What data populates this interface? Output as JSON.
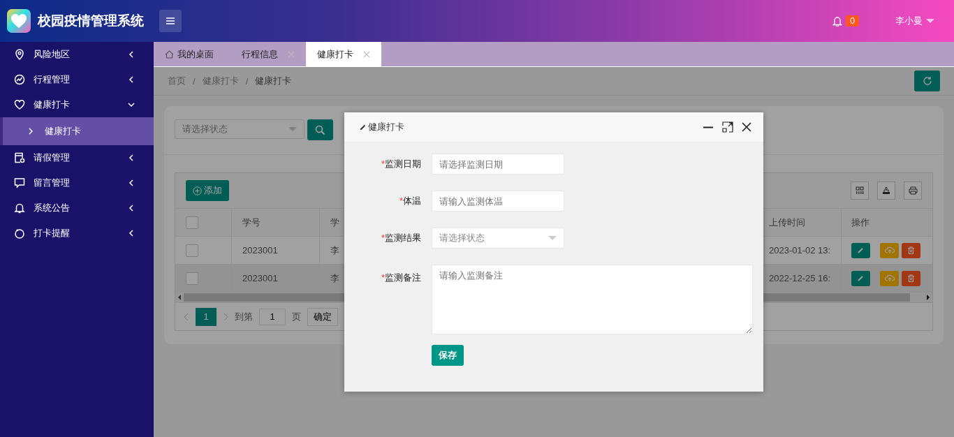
{
  "header": {
    "title": "校园疫情管理系统",
    "notification_count": "0",
    "user": "李小曼"
  },
  "sidebar": {
    "items": [
      {
        "label": "风险地区",
        "expanded": false
      },
      {
        "label": "行程管理",
        "expanded": false
      },
      {
        "label": "健康打卡",
        "expanded": true,
        "children": [
          {
            "label": "健康打卡",
            "selected": true
          }
        ]
      },
      {
        "label": "请假管理",
        "expanded": false
      },
      {
        "label": "留言管理",
        "expanded": false
      },
      {
        "label": "系统公告",
        "expanded": false
      },
      {
        "label": "打卡提醒",
        "expanded": false
      }
    ]
  },
  "tabs": [
    {
      "label": "我的桌面",
      "kind": "home",
      "selected": false
    },
    {
      "label": "行程信息",
      "kind": "page",
      "selected": false
    },
    {
      "label": "健康打卡",
      "kind": "page",
      "selected": true
    }
  ],
  "breadcrumb": [
    {
      "label": "首页"
    },
    {
      "separator": "/",
      "label": "健康打卡"
    },
    {
      "separator": "/",
      "label": "健康打卡"
    }
  ],
  "filter": {
    "placeholder": "请选择状态"
  },
  "toolbar": {
    "add_label": "添加"
  },
  "table": {
    "header_checked": false,
    "columns": [
      "学号",
      "学",
      "上传时间",
      "操作"
    ],
    "rows": [
      {
        "checked": false,
        "hovered": false,
        "cells": [
          "2023001",
          "李",
          "2023-01-02 13:"
        ]
      },
      {
        "checked": false,
        "hovered": true,
        "cells": [
          "2023001",
          "李",
          "2022-12-25 16:"
        ]
      }
    ]
  },
  "pagination": {
    "pages": [
      {
        "label": "1",
        "selected": true
      }
    ],
    "goto_label": "到第",
    "page_input": "1",
    "page_unit": "页",
    "confirm": "确定"
  },
  "modal": {
    "title": "健康打卡",
    "fields": [
      {
        "marker": "*",
        "label": "监测日期",
        "kind": "date",
        "placeholder": "请选择监测日期"
      },
      {
        "marker": "*",
        "label": "体温",
        "kind": "text",
        "placeholder": "请输入监测体温"
      },
      {
        "marker": "*",
        "label": "监测结果",
        "kind": "select",
        "placeholder": "请选择状态"
      },
      {
        "marker": "*",
        "label": "监测备注",
        "kind": "textarea",
        "placeholder": "请输入监测备注"
      }
    ],
    "save": "保存"
  }
}
